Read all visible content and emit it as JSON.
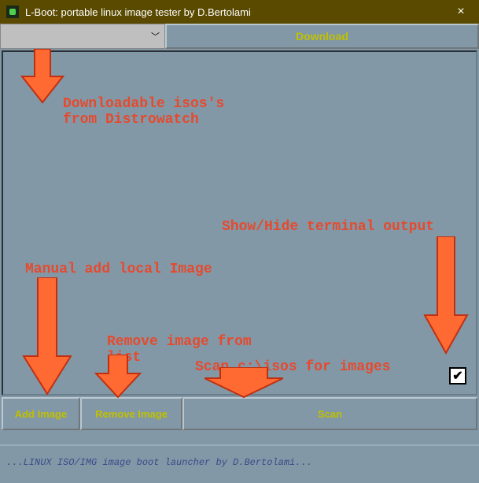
{
  "titlebar": {
    "title": "L-Boot: portable linux image tester by D.Bertolami",
    "close": "×"
  },
  "top": {
    "dropdown_value": "",
    "download_label": "Download"
  },
  "buttons": {
    "add_label": "Add Image",
    "remove_label": "Remove Image",
    "scan_label": "Scan"
  },
  "checkbox": {
    "checked_glyph": "✔"
  },
  "status": {
    "text": "...LINUX ISO/IMG image boot launcher by D.Bertolami..."
  },
  "annotations": {
    "a1": "Downloadable isos's\nfrom Distrowatch",
    "a2": "Show/Hide terminal output",
    "a3": "Manual add local Image",
    "a4": "Remove image from\nlist",
    "a5": "Scan c:\\isos for images"
  }
}
